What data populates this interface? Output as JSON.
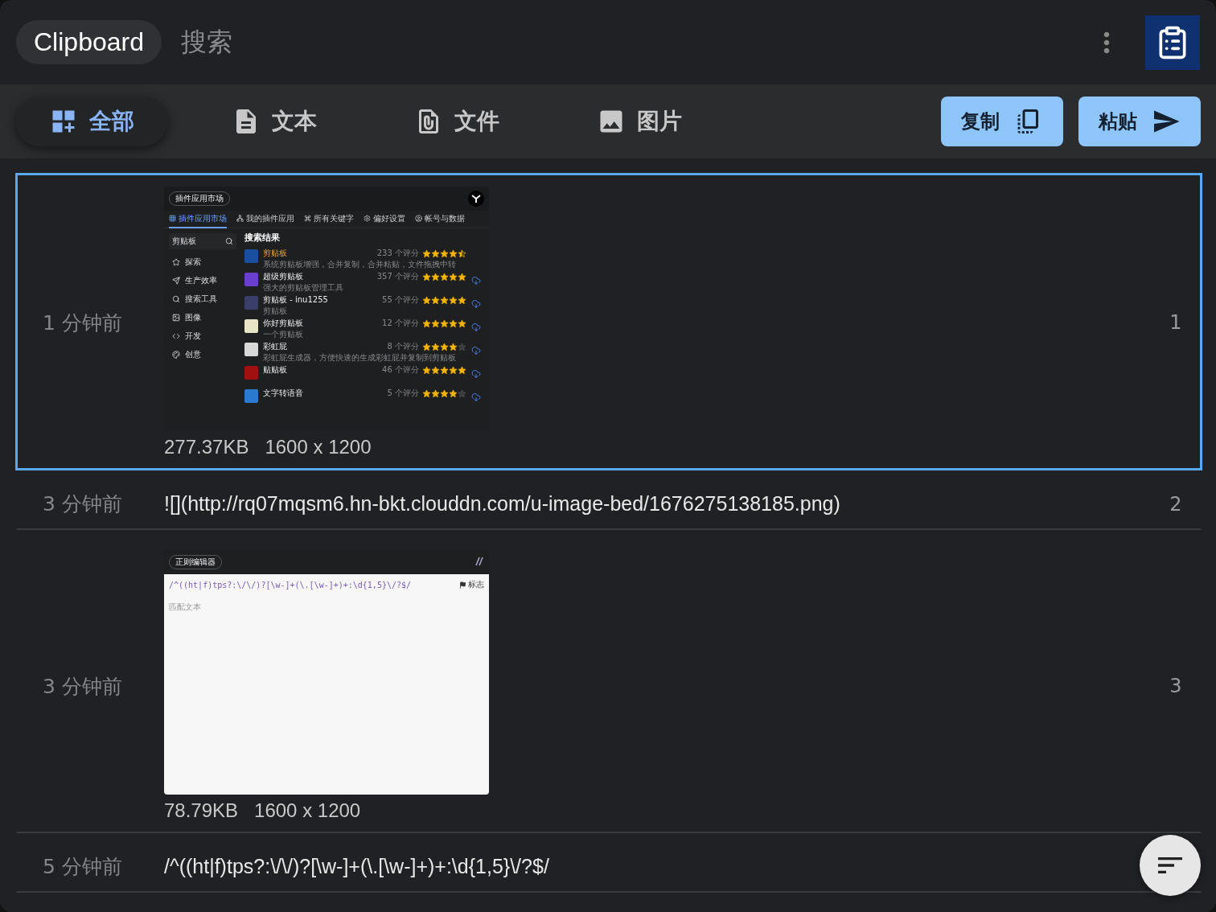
{
  "header": {
    "title": "Clipboard",
    "search_placeholder": "搜索"
  },
  "filters": [
    {
      "label": "全部",
      "selected": true
    },
    {
      "label": "文本",
      "selected": false
    },
    {
      "label": "文件",
      "selected": false
    },
    {
      "label": "图片",
      "selected": false
    }
  ],
  "actions": [
    {
      "label": "复制"
    },
    {
      "label": "粘贴"
    }
  ],
  "items": [
    {
      "kind": "image",
      "time": "1 分钟前",
      "index": "1",
      "selected": true,
      "size": "277.37KB",
      "dimensions": "1600 x 1200",
      "preview": {
        "kind": "market",
        "title": "插件应用市场",
        "tabs": [
          {
            "label": "插件应用市场",
            "selected": true
          },
          {
            "label": "我的插件应用",
            "selected": false
          },
          {
            "label": "所有关键字",
            "selected": false
          },
          {
            "label": "偏好设置",
            "selected": false
          },
          {
            "label": "帐号与数据",
            "selected": false
          }
        ],
        "search_value": "剪贴板",
        "sidebar": [
          {
            "label": "探索"
          },
          {
            "label": "生产效率"
          },
          {
            "label": "搜索工具"
          },
          {
            "label": "图像"
          },
          {
            "label": "开发"
          },
          {
            "label": "创意"
          }
        ],
        "heading": "搜索结果",
        "results": [
          {
            "title": "剪贴板",
            "desc": "系统剪贴板增强，合并复制，合并粘贴，文件拖拽中转",
            "ratings": "233 个评分",
            "stars": 4.5,
            "highlighted": true,
            "downloadable": false,
            "color": "#1a4fa0"
          },
          {
            "title": "超级剪贴板",
            "desc": "强大的剪贴板管理工具",
            "ratings": "357 个评分",
            "stars": 5,
            "highlighted": false,
            "downloadable": true,
            "color": "#6a3fd0"
          },
          {
            "title": "剪贴板 - inu1255",
            "desc": "剪贴板",
            "ratings": "55 个评分",
            "stars": 5,
            "highlighted": false,
            "downloadable": true,
            "color": "#3a3f6a"
          },
          {
            "title": "你好剪贴板",
            "desc": "一个剪贴板",
            "ratings": "12 个评分",
            "stars": 5,
            "highlighted": false,
            "downloadable": true,
            "color": "#e8e4c8"
          },
          {
            "title": "彩虹屁",
            "desc": "彩虹屁生成器，方便快速的生成彩虹屁并复制到剪贴板",
            "ratings": "8 个评分",
            "stars": 4,
            "highlighted": false,
            "downloadable": true,
            "color": "#d8d8d8"
          },
          {
            "title": "贴贴板",
            "ratings": "46 个评分",
            "stars": 5,
            "highlighted": false,
            "downloadable": true,
            "color": "#a01010"
          },
          {
            "title": "文字转语音",
            "ratings": "5 个评分",
            "stars": 4,
            "highlighted": false,
            "downloadable": true,
            "color": "#2a7ad0"
          }
        ]
      }
    },
    {
      "kind": "text",
      "time": "3 分钟前",
      "index": "2",
      "selected": false,
      "text": "![](http://rq07mqsm6.hn-bkt.clouddn.com/u-image-bed/1676275138185.png)"
    },
    {
      "kind": "image",
      "time": "3 分钟前",
      "index": "3",
      "selected": false,
      "size": "78.79KB",
      "dimensions": "1600 x 1200",
      "preview": {
        "kind": "regex",
        "title": "正则编辑器",
        "pattern": "/^((ht|f)tps?:\\/\\/)?[\\w-]+(\\.[\\w-]+)+:\\d{1,5}\\/?$/",
        "flag_label": "标志",
        "placeholder": "匹配文本"
      }
    },
    {
      "kind": "text",
      "time": "5 分钟前",
      "selected": false,
      "text": "/^((ht|f)tps?:\\/\\/)?[\\w-]+(\\.[\\w-]+)+:\\d{1,5}\\/?$/"
    }
  ]
}
